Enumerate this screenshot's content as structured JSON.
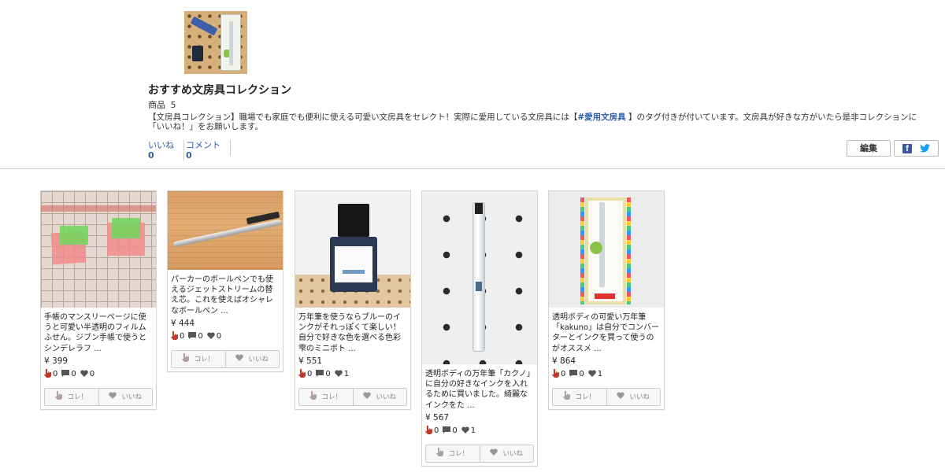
{
  "collection": {
    "title": "おすすめ文房具コレクション",
    "items_label": "商品",
    "items_count": "5",
    "description_pre": "【文房具コレクション】職場でも家庭でも便利に使える可愛い文房具をセレクト！実際に愛用している文房具には【",
    "description_tag": "#愛用文房具",
    "description_post": " 】のタグ付きが付いています。文房具が好きな方がいたら是非コレクションに「いいね！」をお願いします。"
  },
  "stats": [
    {
      "label": "いいね",
      "value": "0"
    },
    {
      "label": "コメント",
      "value": "0"
    }
  ],
  "buttons": {
    "edit": "編集",
    "kore": "コレ！",
    "iine": "いいね"
  },
  "icons": {
    "facebook": "facebook-icon",
    "twitter": "twitter-icon",
    "hand": "pointing-hand-icon",
    "comment": "comment-icon",
    "heart": "heart-icon"
  },
  "colors": {
    "link": "#2b5fa8",
    "facebook": "#3b5998",
    "twitter": "#1da1f2",
    "hand": "#c0392b"
  },
  "cards": [
    {
      "text": "手帳のマンスリーページに使うと可愛い半透明のフィルムふせん。ジブン手帳で使うとシンデレラフ ...",
      "price": "¥ 399",
      "kore": "0",
      "comments": "0",
      "likes": "0"
    },
    {
      "text": "パーカーのボールペンでも使えるジェットストリームの替え芯。これを使えばオシャレなボールペン ...",
      "price": "¥ 444",
      "kore": "0",
      "comments": "0",
      "likes": "0"
    },
    {
      "text": "万年筆を使うならブルーのインクがそれっぽくて楽しい！自分で好きな色を選べる色彩雫のミニボト ...",
      "price": "¥ 551",
      "kore": "0",
      "comments": "0",
      "likes": "1"
    },
    {
      "text": "透明ボディの万年筆「カクノ」に自分の好きなインクを入れるために買いました。綺麗なインクをた ...",
      "price": "¥ 567",
      "kore": "0",
      "comments": "0",
      "likes": "1"
    },
    {
      "text": "透明ボディの可愛い万年筆「kakuno」は自分でコンバーターとインクを買って使うのがオススメ ...",
      "price": "¥ 864",
      "kore": "0",
      "comments": "0",
      "likes": "1"
    }
  ]
}
